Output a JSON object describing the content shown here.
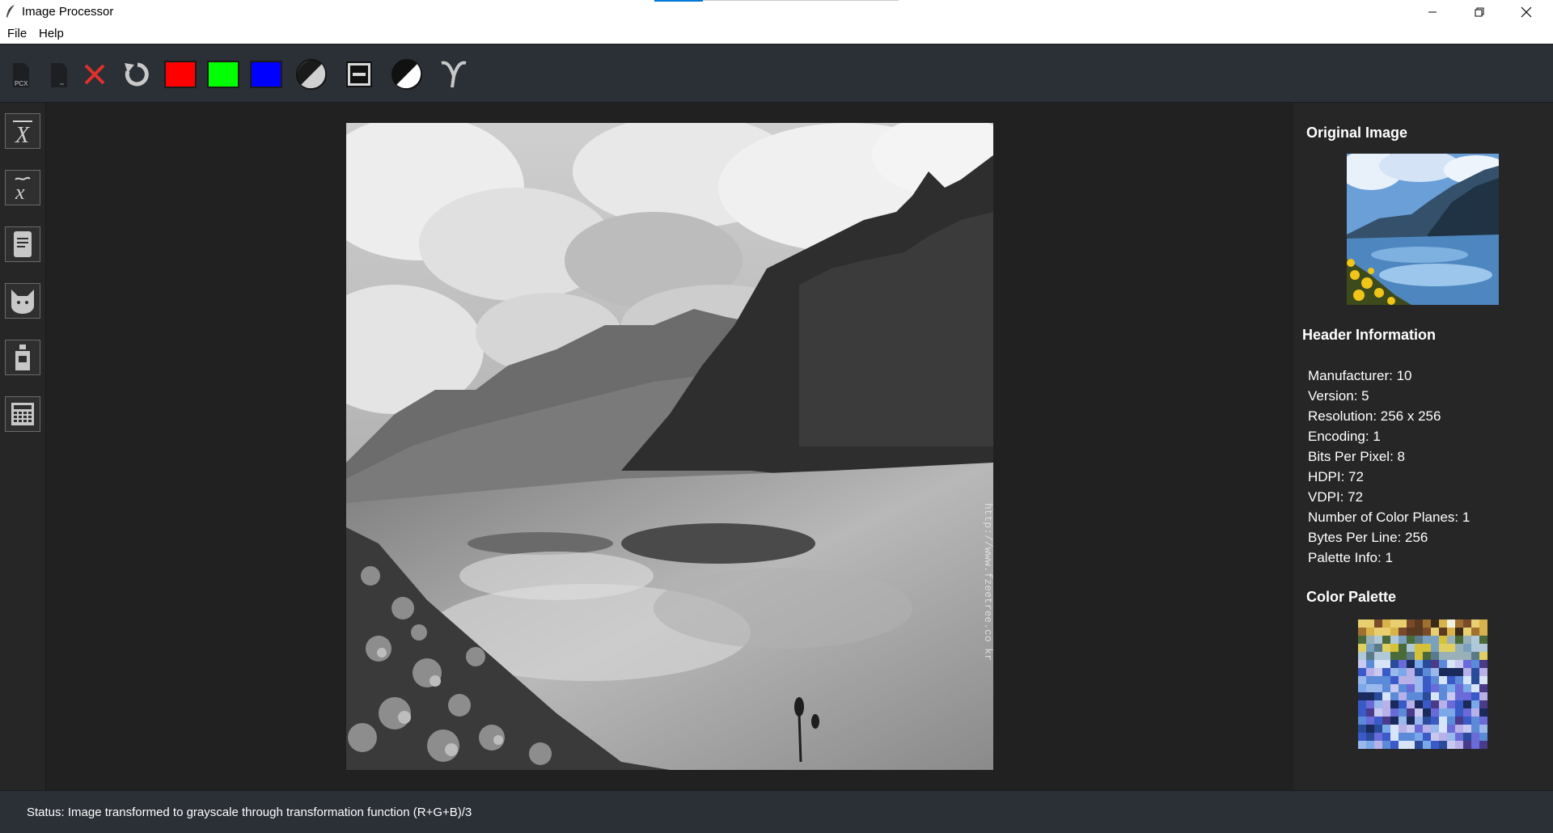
{
  "window": {
    "title": "Image Processor",
    "controls": [
      "minimize-icon",
      "restore-icon",
      "close-icon"
    ]
  },
  "menu": {
    "items": [
      {
        "label": "File"
      },
      {
        "label": "Help"
      }
    ]
  },
  "toolbar": {
    "buttons": [
      {
        "name": "open-pcx-button",
        "icon": "pcx-file-icon",
        "label": "PCX"
      },
      {
        "name": "open-file-button",
        "icon": "file-icon"
      },
      {
        "name": "close-image-button",
        "icon": "close-x-icon",
        "color": "#e0312b"
      },
      {
        "name": "reset-button",
        "icon": "rotate-icon"
      },
      {
        "name": "red-channel-button",
        "icon": "red-square-icon",
        "color": "#ff0000"
      },
      {
        "name": "green-channel-button",
        "icon": "green-square-icon",
        "color": "#00ff00"
      },
      {
        "name": "blue-channel-button",
        "icon": "blue-square-icon",
        "color": "#0000ff"
      },
      {
        "name": "grayscale-button",
        "icon": "half-circle-icon"
      },
      {
        "name": "threshold-button",
        "icon": "minus-box-icon"
      },
      {
        "name": "negative-button",
        "icon": "contrast-icon"
      },
      {
        "name": "gamma-button",
        "icon": "gamma-icon"
      }
    ]
  },
  "sidebar": {
    "buttons": [
      {
        "name": "mean-filter-button",
        "icon": "x-bar-icon"
      },
      {
        "name": "median-filter-button",
        "icon": "x-tilde-icon"
      },
      {
        "name": "laplacian-button",
        "icon": "document-icon"
      },
      {
        "name": "edge-button",
        "icon": "cat-icon"
      },
      {
        "name": "histogram-button",
        "icon": "bottle-icon"
      },
      {
        "name": "noise-button",
        "icon": "grid-icon"
      }
    ]
  },
  "right_panel": {
    "original_heading": "Original Image",
    "header_heading": "Header Information",
    "header_info": [
      "Manufacturer: 10",
      "Version: 5",
      "Resolution: 256 x 256",
      "Encoding: 1",
      "Bits Per Pixel: 8",
      "HDPI: 72",
      "VDPI: 72",
      "Number of Color Planes: 1",
      "Bytes Per Line: 256",
      "Palette Info: 1"
    ],
    "palette_heading": "Color Palette"
  },
  "status": {
    "text": "Status: Image transformed to grayscale through transformation function (R+G+B)/3"
  },
  "image": {
    "watermark": "http://www.fzeetree.co kr"
  }
}
